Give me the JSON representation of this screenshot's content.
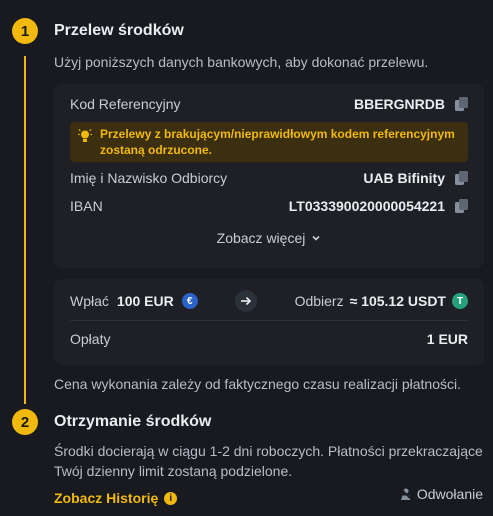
{
  "steps": [
    {
      "number": "1",
      "title": "Przelew środków",
      "subtitle": "Użyj poniższych danych bankowych, aby dokonać przelewu."
    },
    {
      "number": "2",
      "title": "Otrzymanie środków",
      "subtitle": "Środki docierają w ciągu 1-2 dni roboczych. Płatności przekraczające Twój dzienny limit zostaną podzielone."
    }
  ],
  "bank_details": {
    "reference_label": "Kod Referencyjny",
    "reference_value": "BBERGNRDB",
    "warning": "Przelewy z brakującym/nieprawidłowym kodem referencyjnym zostaną odrzucone.",
    "recipient_label": "Imię i Nazwisko Odbiorcy",
    "recipient_value": "UAB Bifinity",
    "iban_label": "IBAN",
    "iban_value": "LT033390020000054221",
    "show_more": "Zobacz więcej"
  },
  "summary": {
    "deposit_label": "Wpłać",
    "deposit_value": "100 EUR",
    "deposit_coin": "€",
    "receive_label": "Odbierz",
    "receive_value": "≈ 105.12 USDT",
    "receive_coin": "T",
    "fee_label": "Opłaty",
    "fee_value": "1 EUR"
  },
  "price_note": "Cena wykonania zależy od faktycznego czasu realizacji płatności.",
  "history_link": "Zobacz Historię",
  "cancel_label": "Odwołanie",
  "colors": {
    "accent": "#f0b90b",
    "background": "#181a20",
    "card": "#1e2026",
    "warning_bg": "#3c2f10"
  }
}
